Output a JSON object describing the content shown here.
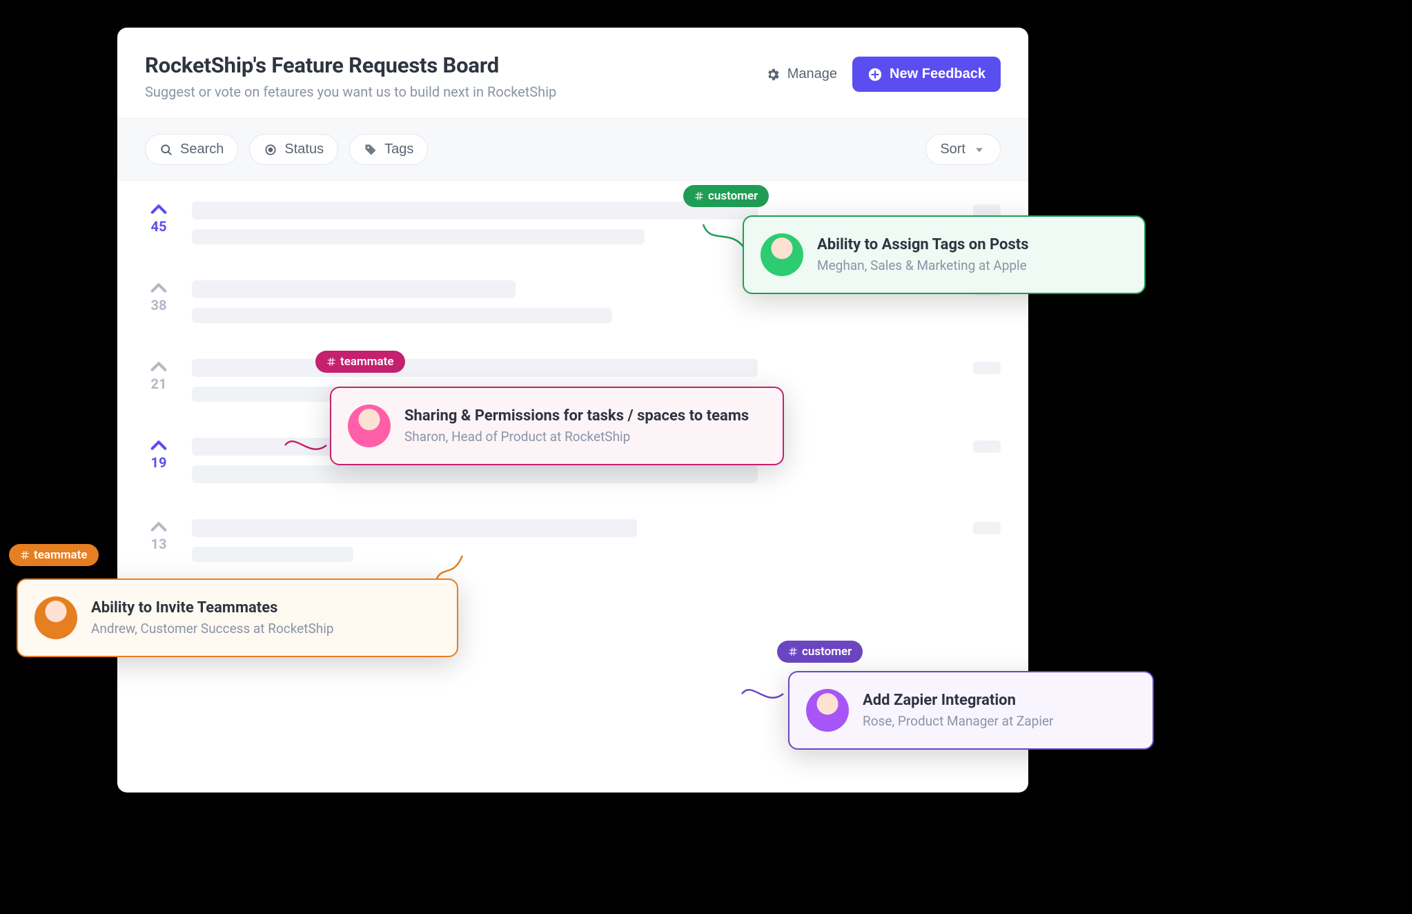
{
  "header": {
    "title": "RocketShip's Feature Requests Board",
    "subtitle": "Suggest or vote on fetaures you want us to build next in RocketShip",
    "manage_label": "Manage",
    "new_feedback_label": "New Feedback"
  },
  "filters": {
    "search_label": "Search",
    "status_label": "Status",
    "tags_label": "Tags",
    "sort_label": "Sort"
  },
  "rows": [
    {
      "votes": 45,
      "active": true
    },
    {
      "votes": 38,
      "active": false
    },
    {
      "votes": 21,
      "active": false
    },
    {
      "votes": 19,
      "active": true
    },
    {
      "votes": 13,
      "active": false
    }
  ],
  "callouts": {
    "green": {
      "tag": "customer",
      "title": "Ability to Assign Tags on Posts",
      "subtitle": "Meghan, Sales & Marketing at Apple"
    },
    "pink": {
      "tag": "teammate",
      "title": "Sharing & Permissions for tasks / spaces to teams",
      "subtitle": "Sharon, Head of Product at RocketShip"
    },
    "orange": {
      "tag": "teammate",
      "title": "Ability to Invite Teammates",
      "subtitle": "Andrew, Customer Success at RocketShip"
    },
    "purple": {
      "tag": "customer",
      "title": "Add Zapier Integration",
      "subtitle": "Rose, Product Manager at Zapier"
    }
  },
  "colors": {
    "accent": "#5b4ef0",
    "green": "#1f9d55",
    "pink": "#c4216f",
    "orange": "#e67e22",
    "purple": "#6b46c1"
  }
}
